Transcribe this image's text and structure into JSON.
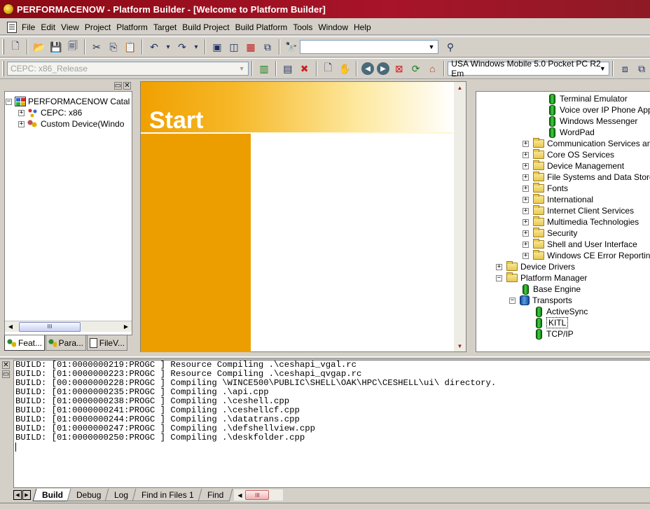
{
  "window": {
    "title": "PERFORMACENOW - Platform Builder - [Welcome to Platform Builder]"
  },
  "menu": [
    "File",
    "Edit",
    "View",
    "Project",
    "Platform",
    "Target",
    "Build Project",
    "Build Platform",
    "Tools",
    "Window",
    "Help"
  ],
  "toolbar": {
    "find_value": "",
    "config_value": "CEPC: x86_Release",
    "sdk_value": "USA Windows Mobile 5.0 Pocket PC R2 Em"
  },
  "catalog_tree": {
    "root": "PERFORMACENOW Catal",
    "children": [
      "CEPC: x86",
      "Custom Device(Windo"
    ]
  },
  "left_tabs": [
    "Feat...",
    "Para...",
    "FileV..."
  ],
  "start_page": {
    "heading": "Start"
  },
  "component_tree": [
    {
      "label": "Terminal Emulator",
      "level": 3,
      "icon": "component"
    },
    {
      "label": "Voice over IP Phone Applic",
      "level": 3,
      "icon": "component"
    },
    {
      "label": "Windows Messenger",
      "level": 3,
      "icon": "component"
    },
    {
      "label": "WordPad",
      "level": 3,
      "icon": "component"
    },
    {
      "label": "Communication Services and N",
      "level": 2,
      "icon": "folder",
      "expander": "+"
    },
    {
      "label": "Core OS Services",
      "level": 2,
      "icon": "folder",
      "expander": "+"
    },
    {
      "label": "Device Management",
      "level": 2,
      "icon": "folder",
      "expander": "+"
    },
    {
      "label": "File Systems and Data Store",
      "level": 2,
      "icon": "folder",
      "expander": "+"
    },
    {
      "label": "Fonts",
      "level": 2,
      "icon": "folder",
      "expander": "+"
    },
    {
      "label": "International",
      "level": 2,
      "icon": "folder",
      "expander": "+"
    },
    {
      "label": "Internet Client Services",
      "level": 2,
      "icon": "folder",
      "expander": "+"
    },
    {
      "label": "Multimedia Technologies",
      "level": 2,
      "icon": "folder",
      "expander": "+"
    },
    {
      "label": "Security",
      "level": 2,
      "icon": "folder",
      "expander": "+"
    },
    {
      "label": "Shell and User Interface",
      "level": 2,
      "icon": "folder",
      "expander": "+"
    },
    {
      "label": "Windows CE Error Reporting",
      "level": 2,
      "icon": "folder",
      "expander": "+"
    },
    {
      "label": "Device Drivers",
      "level": 0,
      "icon": "folder",
      "expander": "+"
    },
    {
      "label": "Platform Manager",
      "level": 0,
      "icon": "folder-open",
      "expander": "-"
    },
    {
      "label": "Base Engine",
      "level": 1,
      "icon": "component"
    },
    {
      "label": "Transports",
      "level": 1,
      "icon": "component-group",
      "expander": "-"
    },
    {
      "label": "ActiveSync",
      "level": 2,
      "icon": "component"
    },
    {
      "label": "KITL",
      "level": 2,
      "icon": "component",
      "selected": true
    },
    {
      "label": "TCP/IP",
      "level": 2,
      "icon": "component"
    }
  ],
  "output_lines": [
    "BUILD: [01:0000000219:PROGC ] Resource Compiling .\\ceshapi_vgal.rc",
    "BUILD: [01:0000000223:PROGC ] Resource Compiling .\\ceshapi_qvgap.rc",
    "BUILD: [00:0000000228:PROGC ] Compiling \\WINCE500\\PUBLIC\\SHELL\\OAK\\HPC\\CESHELL\\ui\\ directory.",
    "BUILD: [01:0000000235:PROGC ] Compiling .\\api.cpp",
    "BUILD: [01:0000000238:PROGC ] Compiling .\\ceshell.cpp",
    "BUILD: [01:0000000241:PROGC ] Compiling .\\ceshellcf.cpp",
    "BUILD: [01:0000000244:PROGC ] Compiling .\\datatrans.cpp",
    "BUILD: [01:0000000247:PROGC ] Compiling .\\defshellview.cpp",
    "BUILD: [01:0000000250:PROGC ] Compiling .\\deskfolder.cpp"
  ],
  "output_tabs": [
    "Build",
    "Debug",
    "Log",
    "Find in Files 1",
    "Find"
  ]
}
